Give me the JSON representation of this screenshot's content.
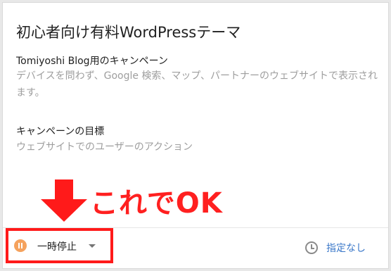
{
  "card": {
    "title": "初心者向け有料WordPressテーマ",
    "campaign_title": "Tomiyoshi Blog用のキャンペーン",
    "campaign_desc": "デバイスを問わず、Google 検索、マップ、パートナーのウェブサイトで表示されます。",
    "goal_title": "キャンペーンの目標",
    "goal_desc": "ウェブサイトでのユーザーのアクション"
  },
  "annotation": {
    "text": "これでOK",
    "color": "#ff2020"
  },
  "footer": {
    "status_label": "一時停止",
    "schedule_label": "指定なし"
  },
  "colors": {
    "pause_icon": "#f5a25d",
    "link": "#3b78c9",
    "highlight": "#ff1a1a"
  }
}
